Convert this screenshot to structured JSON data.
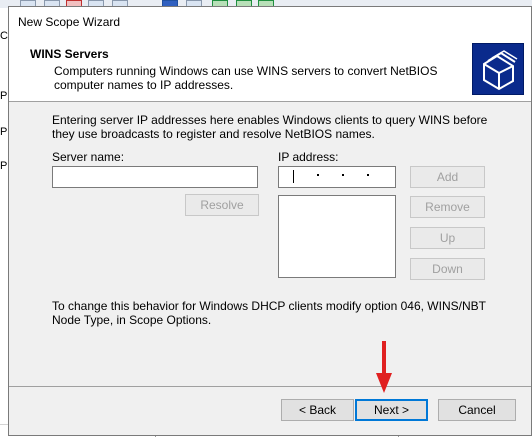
{
  "window": {
    "title": "New Scope Wizard"
  },
  "header": {
    "title": "WINS Servers",
    "subtitle": "Computers running Windows can use WINS servers to convert NetBIOS computer names to IP addresses."
  },
  "description": "Entering server IP addresses here enables Windows clients to query WINS before they use broadcasts to register and resolve NetBIOS names.",
  "fields": {
    "server_name_label": "Server name:",
    "server_name_value": "",
    "ip_address_label": "IP address:",
    "ip_address_value": ""
  },
  "buttons": {
    "resolve": "Resolve",
    "add": "Add",
    "remove": "Remove",
    "up": "Up",
    "down": "Down",
    "back": "< Back",
    "next": "Next >",
    "cancel": "Cancel"
  },
  "footer_note": "To change this behavior for Windows DHCP clients modify option 046, WINS/NBT Node Type, in Scope Options.",
  "background_fragments": [
    "C",
    "P",
    "P",
    "P"
  ],
  "colors": {
    "arrow": "#e02020",
    "accent": "#0078d7",
    "header_icon": "#0a2a8c"
  }
}
